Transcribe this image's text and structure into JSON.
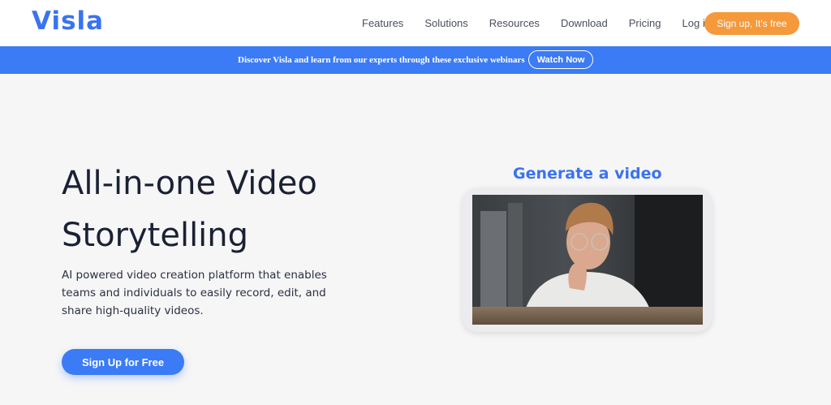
{
  "header": {
    "logo": "Visla",
    "nav": [
      "Features",
      "Solutions",
      "Resources",
      "Download",
      "Pricing",
      "Log in"
    ],
    "signup": "Sign up, It's free"
  },
  "banner": {
    "text": "Discover Visla and learn from our experts through these exclusive webinars",
    "cta": "Watch Now"
  },
  "hero": {
    "title_line1": "All-in-one Video",
    "title_line2": "Storytelling",
    "description": "AI powered video creation platform that enables teams and individuals to easily record, edit, and share high-quality videos.",
    "cta": "Sign Up for Free"
  },
  "video": {
    "heading": "Generate a video"
  },
  "colors": {
    "brand": "#3a73f0",
    "banner": "#3b7bf5",
    "signup_orange": "#f5993b"
  }
}
